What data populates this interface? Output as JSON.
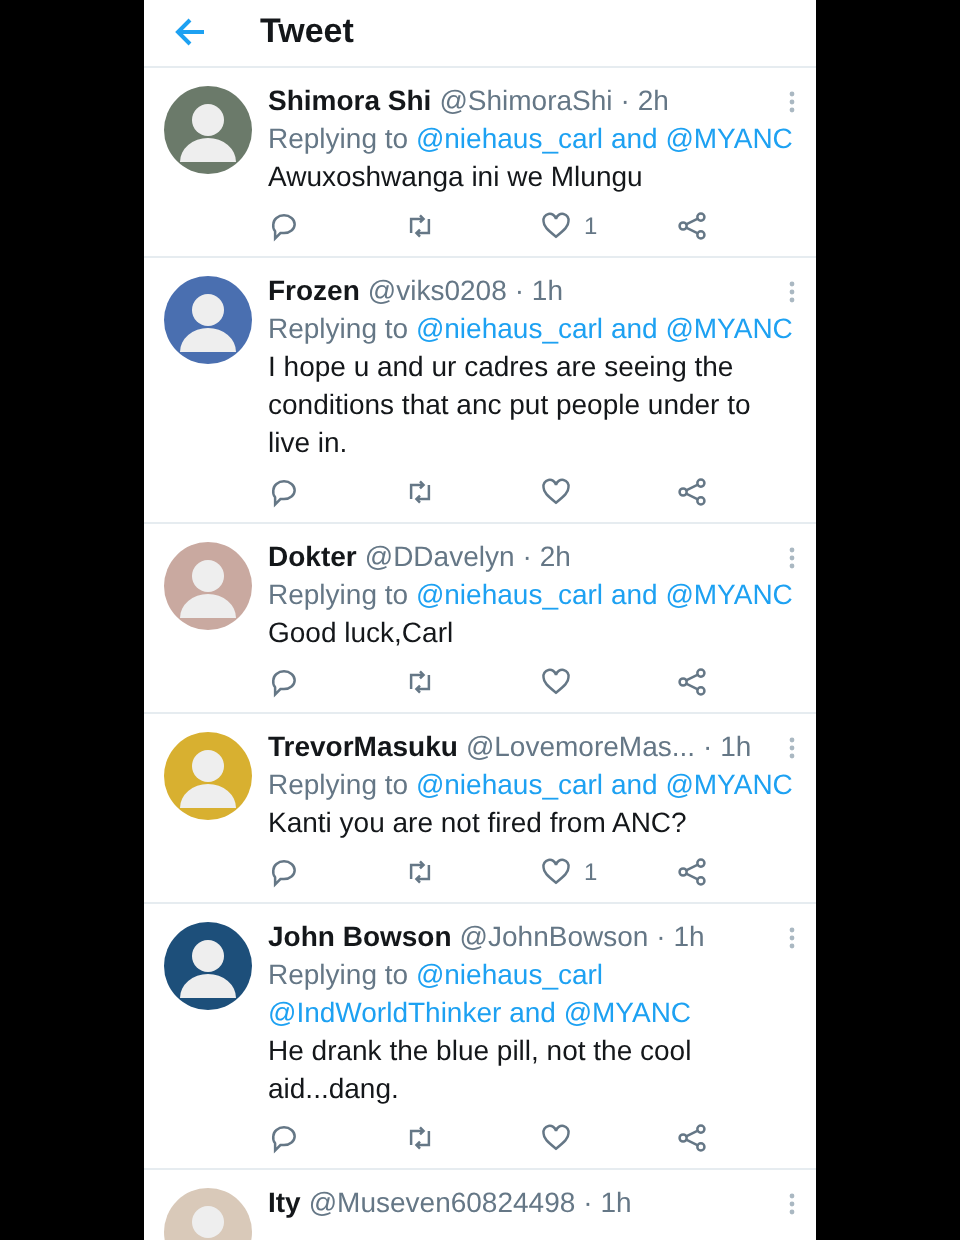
{
  "header": {
    "title": "Tweet"
  },
  "tweets": [
    {
      "name": "Shimora Shi",
      "handle": "@ShimoraShi",
      "time": "· 2h",
      "reply": {
        "prefix": "Replying to",
        "mentions": [
          "@niehaus_carl"
        ],
        "conjunction": "and",
        "last": "@MYANC"
      },
      "text": "Awuxoshwanga ini we Mlungu",
      "likes": "1"
    },
    {
      "name": "Frozen",
      "handle": "@viks0208",
      "time": "· 1h",
      "reply": {
        "prefix": "Replying to",
        "mentions": [
          "@niehaus_carl"
        ],
        "conjunction": "and",
        "last": "@MYANC"
      },
      "text": "I hope u and ur cadres are seeing the conditions that anc put people under to live in."
    },
    {
      "name": "Dokter",
      "handle": "@DDavelyn",
      "time": "· 2h",
      "reply": {
        "prefix": "Replying to",
        "mentions": [
          "@niehaus_carl"
        ],
        "conjunction": "and",
        "last": "@MYANC"
      },
      "text": "Good luck,Carl"
    },
    {
      "name": "TrevorMasuku",
      "handle": "@LovemoreMas...",
      "time": "· 1h",
      "reply": {
        "prefix": "Replying to",
        "mentions": [
          "@niehaus_carl"
        ],
        "conjunction": "and",
        "last": "@MYANC"
      },
      "text": "Kanti you are not fired from ANC?",
      "likes": "1"
    },
    {
      "name": "John Bowson",
      "handle": "@JohnBowson",
      "time": "· 1h",
      "reply": {
        "prefix": "Replying to",
        "mentions": [
          "@niehaus_carl",
          "@IndWorldThinker"
        ],
        "conjunction": "and",
        "last": "@MYANC"
      },
      "text": "He drank the blue pill, not the cool aid...dang."
    },
    {
      "name": "Ity",
      "handle": "@Museven60824498",
      "time": "· 1h"
    }
  ]
}
